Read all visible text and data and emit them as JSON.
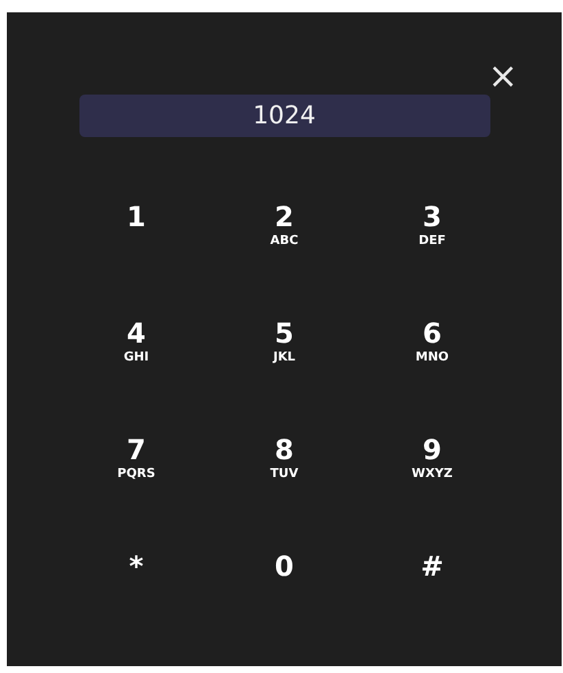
{
  "close": {
    "label": "×"
  },
  "display": {
    "value": "1024"
  },
  "keys": [
    {
      "digit": "1"
    },
    {
      "digit": "2",
      "letters": "ABC"
    },
    {
      "digit": "3",
      "letters": "DEF"
    },
    {
      "digit": "4",
      "letters": "GHI"
    },
    {
      "digit": "5",
      "letters": "JKL"
    },
    {
      "digit": "6",
      "letters": "MNO"
    },
    {
      "digit": "7",
      "letters": "PQRS"
    },
    {
      "digit": "8",
      "letters": "TUV"
    },
    {
      "digit": "9",
      "letters": "WXYZ"
    },
    {
      "digit": "*"
    },
    {
      "digit": "0"
    },
    {
      "digit": "#"
    }
  ]
}
